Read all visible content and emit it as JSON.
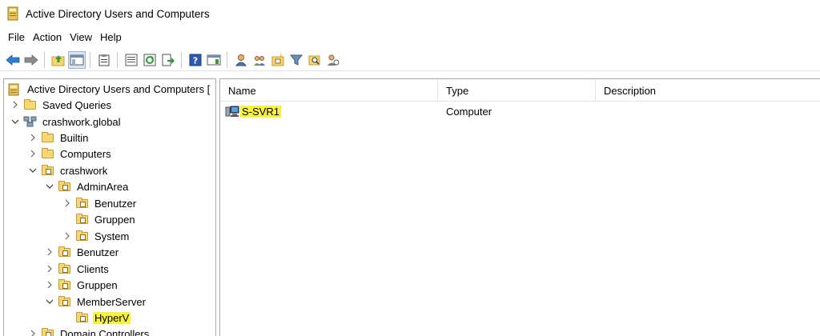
{
  "window": {
    "title": "Active Directory Users and Computers"
  },
  "menu": [
    "File",
    "Action",
    "View",
    "Help"
  ],
  "toolbar": {
    "buttons": [
      "back-icon",
      "forward-icon",
      "up-level-icon",
      "show-hide-console-tree-icon",
      "clipboard-icon",
      "properties-icon",
      "refresh-icon",
      "export-list-icon",
      "help-icon",
      "action-pane-icon",
      "new-user-icon",
      "new-group-icon",
      "new-ou-icon",
      "filter-icon",
      "find-icon",
      "delegate-icon"
    ]
  },
  "tree": {
    "root": "Active Directory Users and Computers [",
    "items": [
      {
        "label": "Saved Queries"
      },
      {
        "label": "crashwork.global"
      },
      {
        "label": "Builtin"
      },
      {
        "label": "Computers"
      },
      {
        "label": "crashwork"
      },
      {
        "label": "AdminArea"
      },
      {
        "label": "Benutzer"
      },
      {
        "label": "Gruppen"
      },
      {
        "label": "System"
      },
      {
        "label": "Benutzer"
      },
      {
        "label": "Clients"
      },
      {
        "label": "Gruppen"
      },
      {
        "label": "MemberServer"
      },
      {
        "label": "HyperV"
      },
      {
        "label": "Domain Controllers"
      }
    ]
  },
  "list": {
    "columns": [
      "Name",
      "Type",
      "Description"
    ],
    "rows": [
      {
        "name": "S-SVR1",
        "type": "Computer",
        "description": ""
      }
    ]
  },
  "colors": {
    "highlight": "#f8f23a",
    "folder": "#f7d774"
  }
}
